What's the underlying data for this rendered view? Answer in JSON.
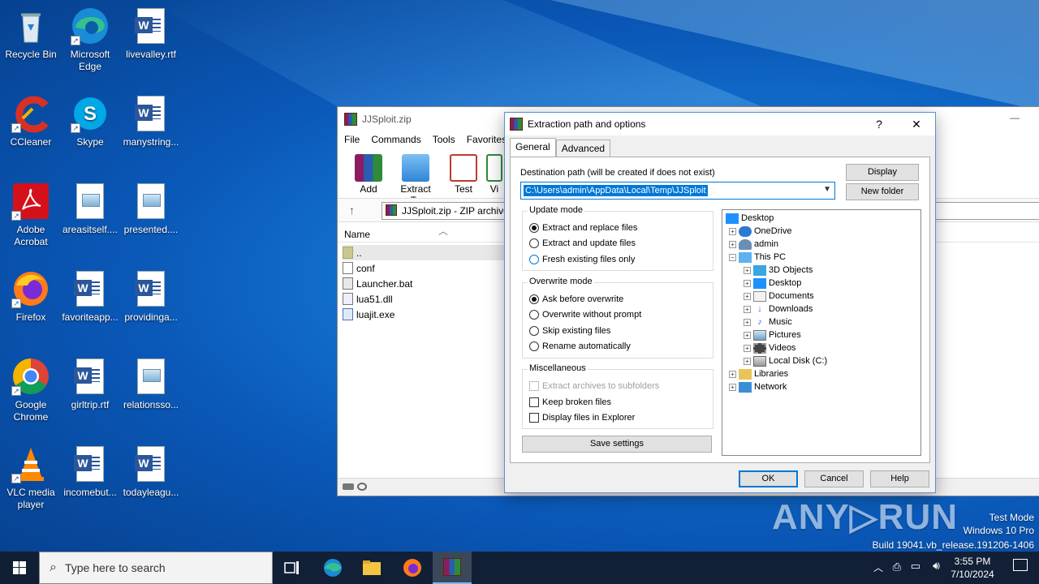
{
  "desktop": {
    "icons": [
      {
        "label": "Recycle Bin"
      },
      {
        "label": "Microsoft Edge"
      },
      {
        "label": "livevalley.rtf"
      },
      {
        "label": "CCleaner"
      },
      {
        "label": "Skype"
      },
      {
        "label": "manystring..."
      },
      {
        "label": "Adobe Acrobat"
      },
      {
        "label": "areasitself...."
      },
      {
        "label": "presented...."
      },
      {
        "label": "Firefox"
      },
      {
        "label": "favoriteapp..."
      },
      {
        "label": "providinga..."
      },
      {
        "label": "Google Chrome"
      },
      {
        "label": "girltrip.rtf"
      },
      {
        "label": "relationsso..."
      },
      {
        "label": "VLC media player"
      },
      {
        "label": "incomebut..."
      },
      {
        "label": "todayleagu..."
      }
    ]
  },
  "winrar": {
    "title": "JJSploit.zip",
    "menu": [
      "File",
      "Commands",
      "Tools",
      "Favorites"
    ],
    "tools": [
      "Add",
      "Extract To",
      "Test",
      "Vi"
    ],
    "path": "JJSploit.zip - ZIP archive,",
    "column_name": "Name",
    "files": [
      "..",
      "conf",
      "Launcher.bat",
      "lua51.dll",
      "luajit.exe"
    ]
  },
  "dialog": {
    "title": "Extraction path and options",
    "help_glyph": "?",
    "close_glyph": "✕",
    "tabs": [
      "General",
      "Advanced"
    ],
    "dest_label": "Destination path (will be created if does not exist)",
    "dest_value": "C:\\Users\\admin\\AppData\\Local\\Temp\\JJSploit",
    "display_button": "Display",
    "new_folder_button": "New folder",
    "update_mode": {
      "title": "Update mode",
      "options": [
        "Extract and replace files",
        "Extract and update files",
        "Fresh existing files only"
      ],
      "selected": 0
    },
    "overwrite_mode": {
      "title": "Overwrite mode",
      "options": [
        "Ask before overwrite",
        "Overwrite without prompt",
        "Skip existing files",
        "Rename automatically"
      ],
      "selected": 0
    },
    "misc": {
      "title": "Miscellaneous",
      "options": [
        "Extract archives to subfolders",
        "Keep broken files",
        "Display files in Explorer"
      ]
    },
    "save_settings": "Save settings",
    "tree": [
      "Desktop",
      "OneDrive",
      "admin",
      "This PC",
      "3D Objects",
      "Desktop",
      "Documents",
      "Downloads",
      "Music",
      "Pictures",
      "Videos",
      "Local Disk (C:)",
      "Libraries",
      "Network"
    ],
    "ok": "OK",
    "cancel": "Cancel",
    "help": "Help"
  },
  "taskbar": {
    "search_placeholder": "Type here to search",
    "time": "3:55 PM",
    "date": "7/10/2024"
  },
  "watermark": {
    "brand": "ANY▷RUN",
    "line1": "Test Mode",
    "line2": "Windows 10 Pro",
    "line3": "Build 19041.vb_release.191206-1406"
  }
}
